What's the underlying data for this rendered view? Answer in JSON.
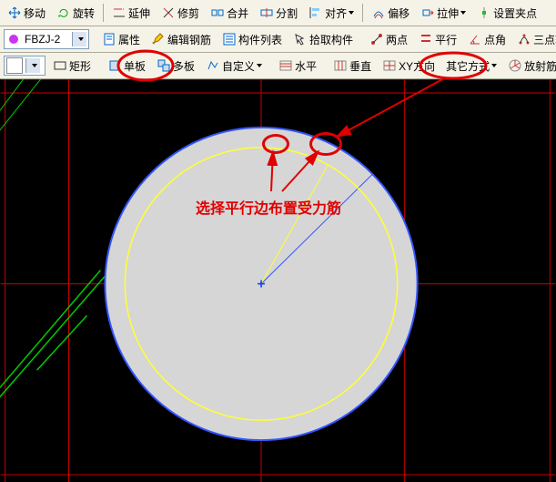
{
  "toolbar1": {
    "btn0": "移动",
    "rotate": "旋转",
    "extend": "延伸",
    "trim": "修剪",
    "fit": "合并",
    "split": "分割",
    "align": "对齐",
    "offset": "偏移",
    "stretch": "拉伸",
    "grip": "设置夹点"
  },
  "toolbar2": {
    "layer": "FBZJ-2",
    "attr": "属性",
    "edit_rebar": "编辑钢筋",
    "component_list": "构件列表",
    "pick_component": "拾取构件",
    "two_point": "两点",
    "parallel": "平行",
    "angle": "点角",
    "three_aux": "三点辅轴"
  },
  "toolbar3": {
    "rect": "矩形",
    "single_plate": "单板",
    "multi_plate": "多板",
    "custom": "自定义",
    "horizontal": "水平",
    "vertical": "垂直",
    "xy_dir": "XY方向",
    "other_way": "其它方式",
    "radial": "放射筋"
  },
  "annotation": {
    "main": "选择平行边布置受力筋"
  }
}
